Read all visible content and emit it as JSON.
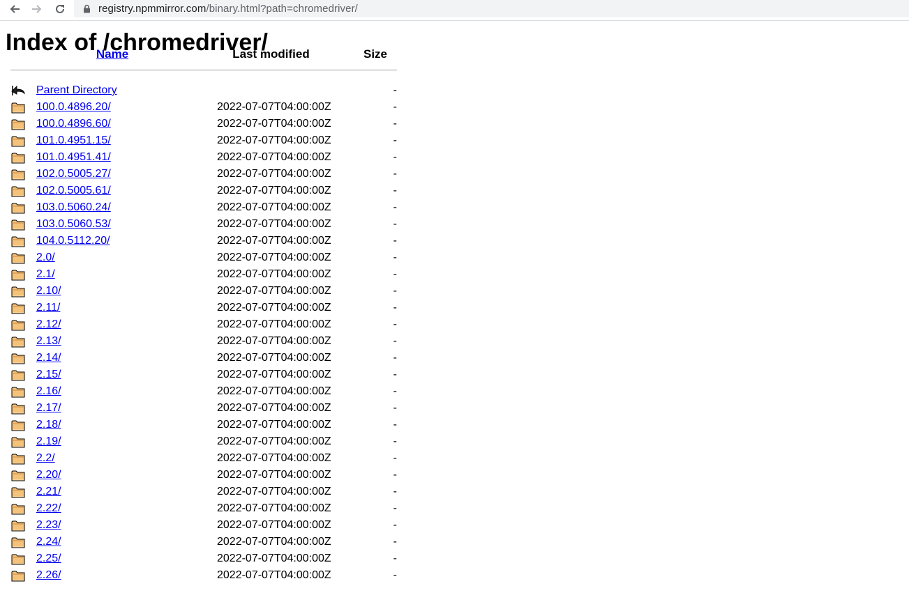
{
  "browser": {
    "url_host": "registry.npmmirror.com",
    "url_path": "/binary.html?path=chromedriver/"
  },
  "page": {
    "title": "Index of /chromedriver/"
  },
  "table": {
    "headers": {
      "name": "Name",
      "last_modified": "Last modified",
      "size": "Size"
    },
    "parent": {
      "name": "Parent Directory",
      "size": "-",
      "icon": "back-arrow-icon"
    },
    "rows": [
      {
        "name": "100.0.4896.20/",
        "modified": "2022-07-07T04:00:00Z",
        "size": "-"
      },
      {
        "name": "100.0.4896.60/",
        "modified": "2022-07-07T04:00:00Z",
        "size": "-"
      },
      {
        "name": "101.0.4951.15/",
        "modified": "2022-07-07T04:00:00Z",
        "size": "-"
      },
      {
        "name": "101.0.4951.41/",
        "modified": "2022-07-07T04:00:00Z",
        "size": "-"
      },
      {
        "name": "102.0.5005.27/",
        "modified": "2022-07-07T04:00:00Z",
        "size": "-"
      },
      {
        "name": "102.0.5005.61/",
        "modified": "2022-07-07T04:00:00Z",
        "size": "-"
      },
      {
        "name": "103.0.5060.24/",
        "modified": "2022-07-07T04:00:00Z",
        "size": "-"
      },
      {
        "name": "103.0.5060.53/",
        "modified": "2022-07-07T04:00:00Z",
        "size": "-"
      },
      {
        "name": "104.0.5112.20/",
        "modified": "2022-07-07T04:00:00Z",
        "size": "-"
      },
      {
        "name": "2.0/",
        "modified": "2022-07-07T04:00:00Z",
        "size": "-"
      },
      {
        "name": "2.1/",
        "modified": "2022-07-07T04:00:00Z",
        "size": "-"
      },
      {
        "name": "2.10/",
        "modified": "2022-07-07T04:00:00Z",
        "size": "-"
      },
      {
        "name": "2.11/",
        "modified": "2022-07-07T04:00:00Z",
        "size": "-"
      },
      {
        "name": "2.12/",
        "modified": "2022-07-07T04:00:00Z",
        "size": "-"
      },
      {
        "name": "2.13/",
        "modified": "2022-07-07T04:00:00Z",
        "size": "-"
      },
      {
        "name": "2.14/",
        "modified": "2022-07-07T04:00:00Z",
        "size": "-"
      },
      {
        "name": "2.15/",
        "modified": "2022-07-07T04:00:00Z",
        "size": "-"
      },
      {
        "name": "2.16/",
        "modified": "2022-07-07T04:00:00Z",
        "size": "-"
      },
      {
        "name": "2.17/",
        "modified": "2022-07-07T04:00:00Z",
        "size": "-"
      },
      {
        "name": "2.18/",
        "modified": "2022-07-07T04:00:00Z",
        "size": "-"
      },
      {
        "name": "2.19/",
        "modified": "2022-07-07T04:00:00Z",
        "size": "-"
      },
      {
        "name": "2.2/",
        "modified": "2022-07-07T04:00:00Z",
        "size": "-"
      },
      {
        "name": "2.20/",
        "modified": "2022-07-07T04:00:00Z",
        "size": "-"
      },
      {
        "name": "2.21/",
        "modified": "2022-07-07T04:00:00Z",
        "size": "-"
      },
      {
        "name": "2.22/",
        "modified": "2022-07-07T04:00:00Z",
        "size": "-"
      },
      {
        "name": "2.23/",
        "modified": "2022-07-07T04:00:00Z",
        "size": "-"
      },
      {
        "name": "2.24/",
        "modified": "2022-07-07T04:00:00Z",
        "size": "-"
      },
      {
        "name": "2.25/",
        "modified": "2022-07-07T04:00:00Z",
        "size": "-"
      },
      {
        "name": "2.26/",
        "modified": "2022-07-07T04:00:00Z",
        "size": "-"
      }
    ],
    "row_icon": "folder-icon"
  },
  "colors": {
    "link": "#0000ee",
    "folder_fill": "#f5c27a",
    "folder_stroke": "#000000"
  }
}
